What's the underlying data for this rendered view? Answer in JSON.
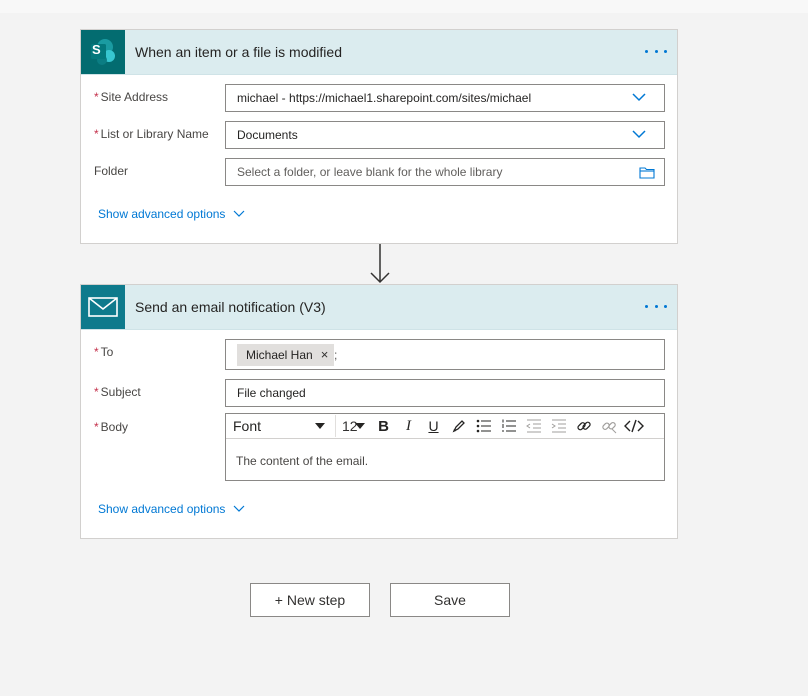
{
  "trigger": {
    "title": "When an item or a file is modified",
    "icon": "sharepoint-icon",
    "icon_letter": "S",
    "brand_color": "#036c70",
    "fields": {
      "site_address": {
        "label": "Site Address",
        "value": "michael - https://michael1.sharepoint.com/sites/michael"
      },
      "list_name": {
        "label": "List or Library Name",
        "value": "Documents"
      },
      "folder": {
        "label": "Folder",
        "placeholder": "Select a folder, or leave blank for the whole library"
      }
    },
    "advanced_label": "Show advanced options"
  },
  "action": {
    "title": "Send an email notification (V3)",
    "icon": "mail-icon",
    "brand_color": "#0e7a8c",
    "fields": {
      "to": {
        "label": "To",
        "token": "Michael Han",
        "token_remove": "×",
        "separator": ";"
      },
      "subject": {
        "label": "Subject",
        "value": "File changed"
      },
      "body": {
        "label": "Body",
        "font": "Font",
        "size": "12",
        "content": "The content of the email."
      }
    },
    "advanced_label": "Show advanced options"
  },
  "required_marker": "*",
  "footer": {
    "new_step": "+ New step",
    "save": "Save"
  },
  "colors": {
    "accent": "#0078d4",
    "header_bg": "#dbecef",
    "required": "#c4314b"
  }
}
